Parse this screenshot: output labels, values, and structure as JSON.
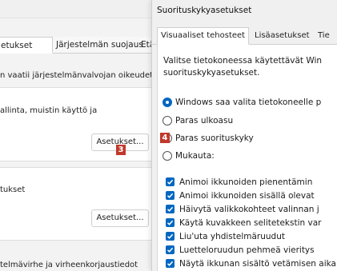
{
  "colors": {
    "accent": "#0067c0",
    "badge": "#c0392b",
    "dialog_bg": "#f0f0f0"
  },
  "back_window": {
    "tabs": [
      "etukset",
      "Järjestelmän suojaus",
      "Etäkä"
    ],
    "admin_note": "n vaatii järjestelmänvalvojan oikeudet.",
    "perf_text": "allinta, muistin käyttö ja",
    "settings_btn_1": "Asetukset...",
    "badge_3": "3",
    "section_2": "tukset",
    "settings_btn_2": "Asetukset...",
    "bottom_text": "telmävirhe ja virheenkorjaustiedot"
  },
  "dialog": {
    "title": "Suorituskykyasetukset",
    "tabs": [
      "Visuaaliset tehosteet",
      "Lisäasetukset",
      "Tie"
    ],
    "description": [
      "Valitse tietokoneessa käytettävät Win",
      "suorituskykyasetukset."
    ],
    "radios": [
      {
        "label": "Windows saa valita tietokoneelle p",
        "selected": true
      },
      {
        "label": "Paras ulkoasu",
        "selected": false
      },
      {
        "label": "Paras suorituskyky",
        "selected": false
      },
      {
        "label": "Mukauta:",
        "selected": false
      }
    ],
    "badge_4": "4",
    "checkboxes": [
      "Animoi ikkunoiden pienentämin",
      "Animoi ikkunoiden sisällä olevat",
      "Häivytä valikkokohteet valinnan j",
      "Käytä kuvakkeen selitetekstin var",
      "Liu'uta yhdistelmäruudut",
      "Luetteloruudun pehmeä vieritys",
      "Näytä ikkunan sisältö vetämisen aikana"
    ]
  }
}
